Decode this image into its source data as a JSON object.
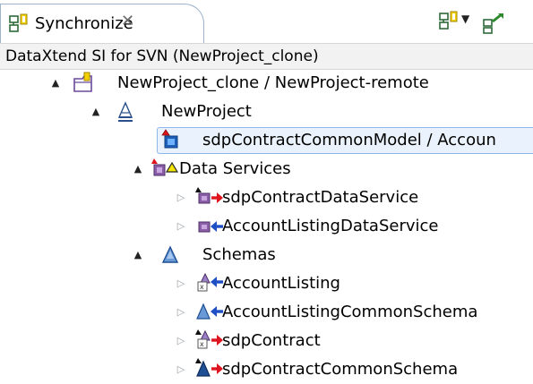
{
  "tab": {
    "title": "Synchronize",
    "close_glyph": "✕",
    "icon": "synchronize-view-icon"
  },
  "toolbar": {
    "sync_icon": "synchronize-icon",
    "dropdown_glyph": "▼",
    "other_icon": "commit-icon"
  },
  "scope": {
    "label": "DataXtend SI for SVN (NewProject_clone)"
  },
  "tree": {
    "rows": [
      {
        "label": "NewProject_clone / NewProject-remote",
        "icon": "project-folder-icon",
        "expand": "▲",
        "indent": 0
      },
      {
        "label": "NewProject",
        "icon": "project-model-icon",
        "expand": "▲",
        "indent": 1
      },
      {
        "label": "sdpContractCommonModel / Accoun",
        "icon": "model-conflict-icon",
        "expand": "",
        "indent": 2,
        "selected": true
      },
      {
        "label": "Data Services",
        "icon": "data-services-folder-icon",
        "expand": "▲",
        "indent": 2
      },
      {
        "label": "sdpContractDataService",
        "icon": "dataservice-outgoing-icon",
        "expand": "▷",
        "indent": 3
      },
      {
        "label": "AccountListingDataService",
        "icon": "dataservice-incoming-icon",
        "expand": "▷",
        "indent": 3
      },
      {
        "label": "Schemas",
        "icon": "schemas-folder-icon",
        "expand": "▲",
        "indent": 2
      },
      {
        "label": "AccountListing",
        "icon": "schema-xml-incoming-icon",
        "expand": "▷",
        "indent": 3
      },
      {
        "label": "AccountListingCommonSchema",
        "icon": "schema-incoming-icon",
        "expand": "▷",
        "indent": 3
      },
      {
        "label": "sdpContract",
        "icon": "schema-xml-outgoing-icon",
        "expand": "▷",
        "indent": 3
      },
      {
        "label": "sdpContractCommonSchema",
        "icon": "schema-outgoing-icon",
        "expand": "▷",
        "indent": 3
      }
    ]
  },
  "colors": {
    "selection_bg": "#eaf3fd",
    "selection_border": "#8fb8e8",
    "incoming_arrow": "#1e4fc4",
    "outgoing_arrow": "#e0141e",
    "ds_purple": "#8b5ea8"
  }
}
